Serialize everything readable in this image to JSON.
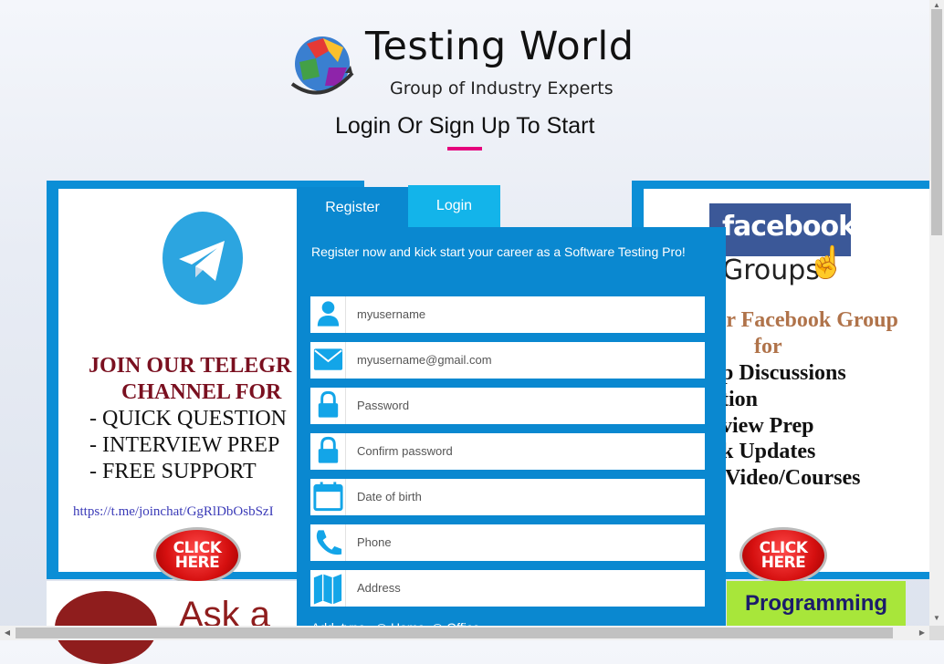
{
  "header": {
    "brand_title": "Testing World",
    "brand_tagline": "Group of Industry Experts",
    "headline": "Login Or Sign Up To Start",
    "accent_color": "#e5007d"
  },
  "telegram_ad": {
    "heading_1": "JOIN OUR TELEGR",
    "heading_2": "CHANNEL  FOR",
    "bullet_1": "- QUICK QUESTION",
    "bullet_2": "- INTERVIEW PREP",
    "bullet_3": "- FREE SUPPORT",
    "link": "https://t.me/joinchat/GgRlDbOsbSzI",
    "click_line_1": "CLICK",
    "click_line_2": "HERE",
    "icon": "telegram-icon"
  },
  "facebook_ad": {
    "logo_text": "facebook",
    "groups_text": "Groups",
    "heading_1": "ur Facebook Group",
    "heading_2": "for",
    "bullet_1": "p Discussions",
    "bullet_2": "tion",
    "bullet_3": "view Prep",
    "bullet_4": "k Updates",
    "bullet_5": "Video/Courses",
    "click_line_1": "CLICK",
    "click_line_2": "HERE"
  },
  "banners": {
    "ask_text": "Ask a",
    "programming_text": "Programming"
  },
  "form": {
    "tabs": [
      {
        "label": "Register",
        "active": true
      },
      {
        "label": "Login",
        "active": false
      }
    ],
    "intro": "Register now and kick start your career as a Software Testing Pro!",
    "fields": {
      "username": {
        "placeholder": "myusername",
        "icon": "user-icon"
      },
      "email": {
        "placeholder": "myusername@gmail.com",
        "icon": "envelope-icon"
      },
      "password": {
        "placeholder": "Password",
        "icon": "lock-icon"
      },
      "confirm_password": {
        "placeholder": "Confirm password",
        "icon": "lock-icon"
      },
      "dob": {
        "placeholder": "Date of birth",
        "icon": "calendar-icon"
      },
      "phone": {
        "placeholder": "Phone",
        "icon": "phone-icon"
      },
      "address": {
        "placeholder": "Address",
        "icon": "map-icon"
      }
    },
    "address_type_label": "Add. type",
    "address_options": [
      "Home",
      "Office"
    ],
    "colors": {
      "panel": "#0a88d0",
      "login_tab": "#13b4ea",
      "icon": "#13a5e8"
    }
  }
}
